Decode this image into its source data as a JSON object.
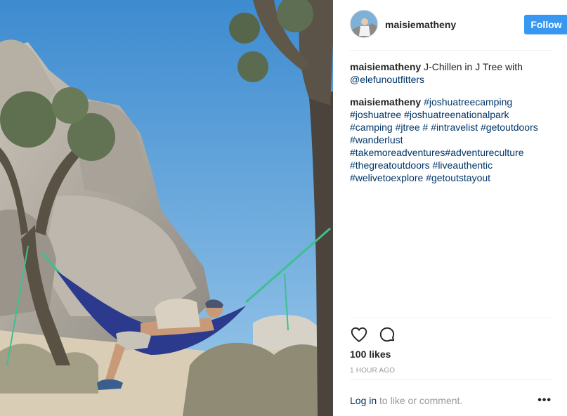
{
  "post": {
    "username": "maisiematheny",
    "follow_label": "Follow",
    "caption": {
      "user": "maisiematheny",
      "text": "J-Chillen in J Tree with",
      "mention": "@elefunoutfitters"
    },
    "comment": {
      "user": "maisiematheny",
      "hashtags": [
        "#joshuatreecamping",
        "#joshuatree",
        "#joshuatreenationalpark",
        "#camping",
        "#jtree",
        "#",
        "#intravelist",
        "#getoutdoors",
        "#wanderlust",
        "#takemoreadventures#adventureculture",
        "#thegreatoutdoors",
        "#liveauthentic",
        "#welivetoexplore",
        "#getoutstayout"
      ]
    },
    "likes": "100 likes",
    "timestamp": "1 HOUR AGO",
    "login_link": "Log in",
    "login_rest": " to like or comment.",
    "more_label": "•••"
  },
  "icons": {
    "like": "heart-icon",
    "comment": "comment-icon",
    "more": "more-options-icon"
  },
  "colors": {
    "follow_button": "#3897f0",
    "link": "#003569",
    "muted": "#999999",
    "sky": "#4d97d6"
  }
}
